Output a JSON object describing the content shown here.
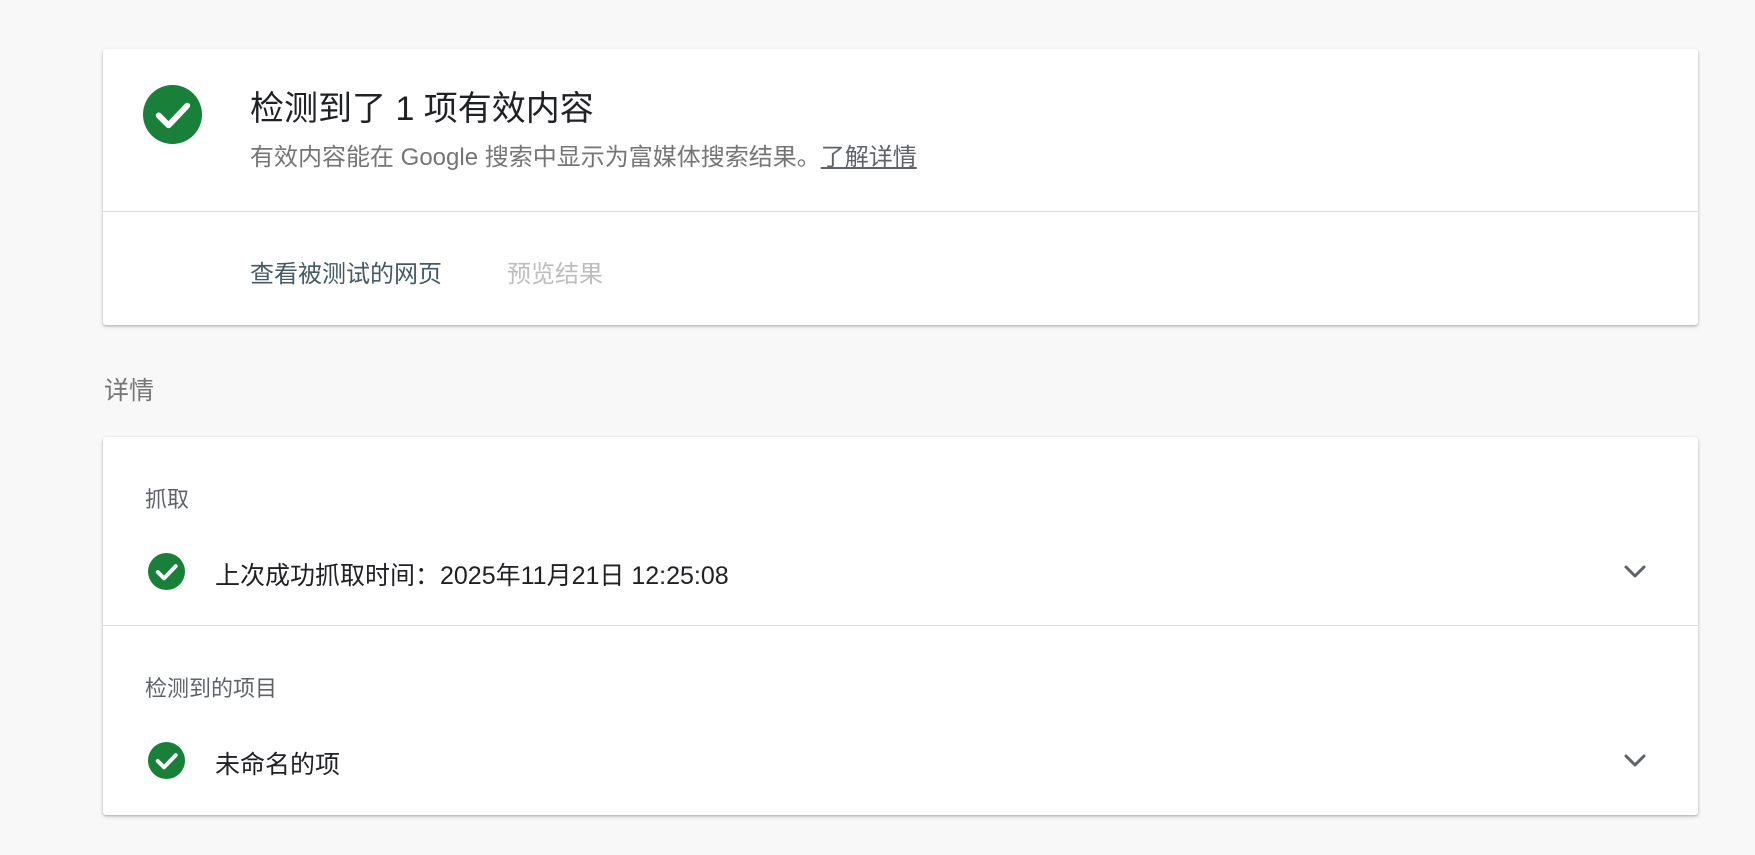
{
  "summary": {
    "title": "检测到了 1 项有效内容",
    "description": "有效内容能在 Google 搜索中显示为富媒体搜索结果。",
    "learn_more": "了解详情",
    "actions": {
      "view_tested_page": "查看被测试的网页",
      "preview_results": "预览结果"
    }
  },
  "details": {
    "heading": "详情",
    "crawl": {
      "label": "抓取",
      "status_text": "上次成功抓取时间：2025年11月21日 12:25:08",
      "status_icon": "check-circle-icon"
    },
    "detected_items": {
      "label": "检测到的项目",
      "item_text": "未命名的项",
      "status_icon": "check-circle-icon"
    }
  },
  "colors": {
    "success_green": "#188038",
    "background": "#f8f8f8",
    "muted_text": "#757575"
  }
}
